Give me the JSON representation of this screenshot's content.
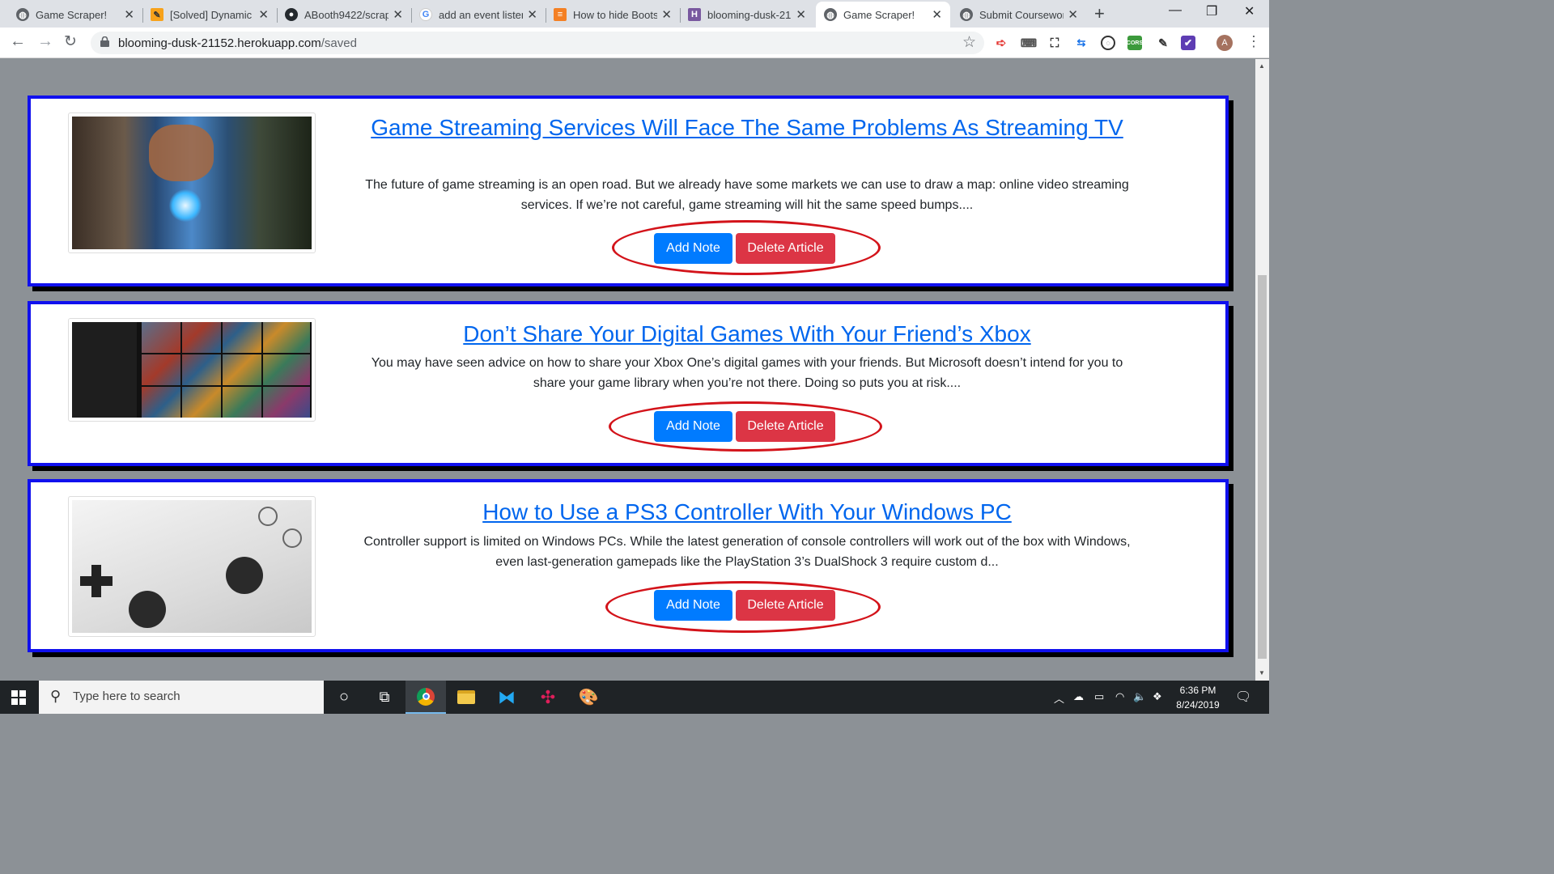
{
  "browser": {
    "tabs": [
      {
        "title": "Game Scraper!",
        "icon": "globe-icon"
      },
      {
        "title": "[Solved] Dynamic I",
        "icon": "codeproject-icon"
      },
      {
        "title": "ABooth9422/scrap",
        "icon": "github-icon"
      },
      {
        "title": "add an event listen",
        "icon": "google-icon"
      },
      {
        "title": "How to hide Boots",
        "icon": "stackoverflow-icon"
      },
      {
        "title": "blooming-dusk-21",
        "icon": "heroku-icon"
      },
      {
        "title": "Game Scraper!",
        "icon": "globe-icon",
        "active": true
      },
      {
        "title": "Submit Coursewor",
        "icon": "globe-icon"
      }
    ],
    "url_host": "blooming-dusk-21152.herokuapp.com",
    "url_path": "/saved",
    "profile_initial": "A"
  },
  "articles": [
    {
      "title": "Game Streaming Services Will Face The Same Problems As Streaming TV",
      "summary": "The future of game streaming is an open road. But we already have some markets we can use to draw a map: online video streaming services. If we’re not careful, game streaming will hit the same speed bumps....",
      "add_note_label": "Add Note",
      "delete_label": "Delete Article"
    },
    {
      "title": "Don’t Share Your Digital Games With Your Friend’s Xbox",
      "summary": "You may have seen advice on how to share your Xbox One’s digital games with your friends. But Microsoft doesn’t intend for you to share your game library when you’re not there. Doing so puts you at risk....",
      "add_note_label": "Add Note",
      "delete_label": "Delete Article"
    },
    {
      "title": "How to Use a PS3 Controller With Your Windows PC",
      "summary": "Controller support is limited on Windows PCs. While the latest generation of console controllers will work out of the box with Windows, even last-generation gamepads like the PlayStation 3’s DualShock 3 require custom d...",
      "add_note_label": "Add Note",
      "delete_label": "Delete Article"
    }
  ],
  "taskbar": {
    "search_placeholder": "Type here to search",
    "time": "6:36 PM",
    "date": "8/24/2019"
  },
  "colors": {
    "card_border": "#1010ee",
    "add_note": "#007bff",
    "delete": "#dc3545",
    "annotation": "#d3131a"
  }
}
